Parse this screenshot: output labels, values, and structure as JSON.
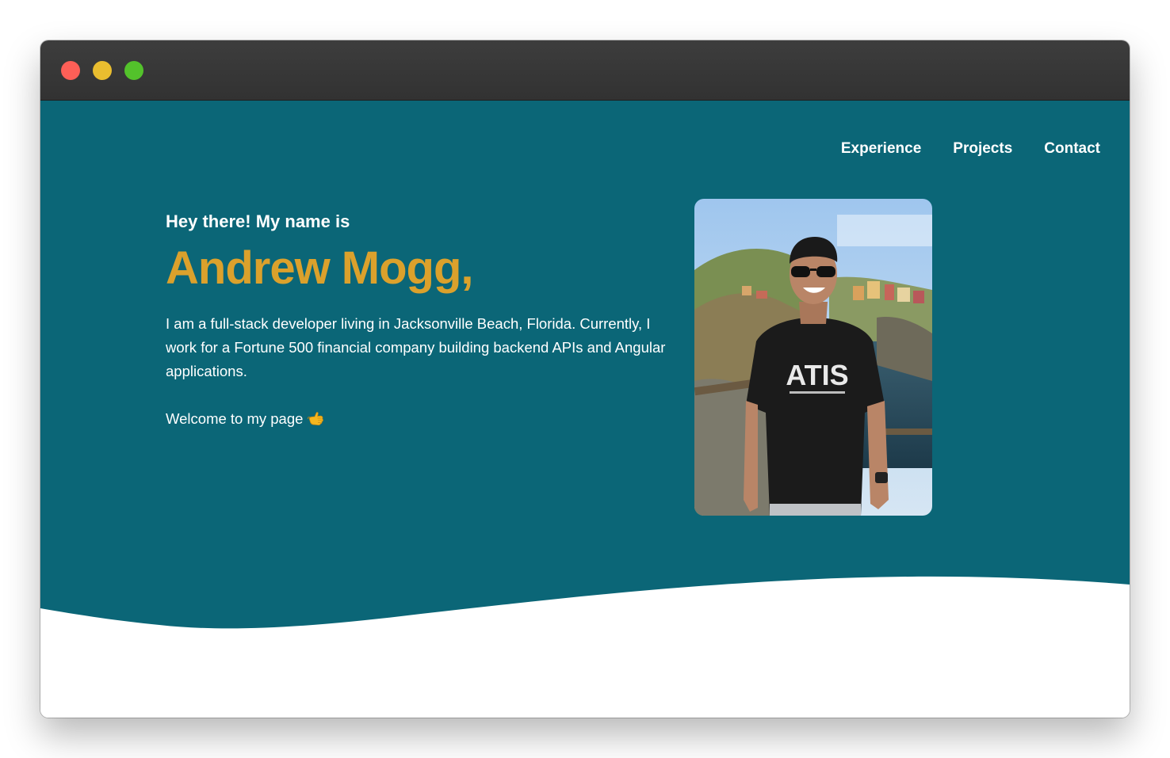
{
  "window": {
    "controls": [
      "close",
      "minimize",
      "maximize"
    ]
  },
  "nav": {
    "items": [
      {
        "label": "Experience"
      },
      {
        "label": "Projects"
      },
      {
        "label": "Contact"
      }
    ]
  },
  "hero": {
    "greeting": "Hey there! My name is",
    "name": "Andrew Mogg,",
    "bio": "I am a full-stack developer living in Jacksonville Beach, Florida. Currently, I work for a Fortune 500 financial company building backend APIs and Angular applications.",
    "welcome": "Welcome to my page",
    "welcome_icon": "call-me-hand-icon",
    "photo_icon": "profile-photo",
    "shirt_text": "ATIS"
  },
  "colors": {
    "hero_bg": "#0b6677",
    "accent": "#dba12c",
    "titlebar": "#363636",
    "close": "#fe5f57",
    "minimize": "#e9bd2f",
    "maximize": "#53c22b"
  }
}
